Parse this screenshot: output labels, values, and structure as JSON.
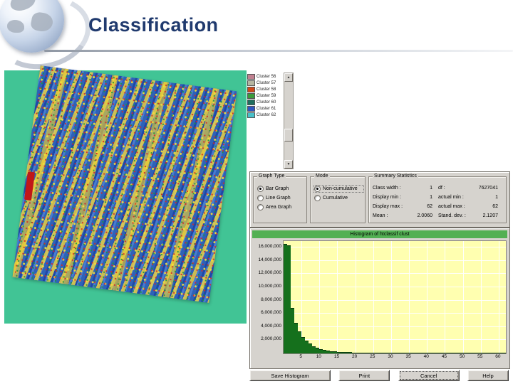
{
  "slide": {
    "title": "Classification"
  },
  "icons": {
    "scroll_up": "▲",
    "scroll_down": "▼"
  },
  "colors": {
    "panel_teal": "#41c495",
    "dialog_gray": "#d6d3ce",
    "bar_green": "#15701c",
    "plot_yellow": "#ffffb0",
    "hist_title_green": "#53b053",
    "title_navy": "#203a6e"
  },
  "legend": {
    "items": [
      {
        "label": "Cluster 56",
        "color": "#c08090"
      },
      {
        "label": "Cluster 57",
        "color": "#b5b5a0"
      },
      {
        "label": "Cluster 58",
        "color": "#d04818"
      },
      {
        "label": "Cluster 59",
        "color": "#3a9a3a"
      },
      {
        "label": "Cluster 60",
        "color": "#1f6e5e"
      },
      {
        "label": "Cluster 61",
        "color": "#2f55c0"
      },
      {
        "label": "Cluster 62",
        "color": "#49c0c9"
      }
    ]
  },
  "dialog": {
    "graph_type": {
      "label": "Graph Type",
      "options": [
        {
          "label": "Bar Graph",
          "selected": true
        },
        {
          "label": "Line Graph",
          "selected": false
        },
        {
          "label": "Area Graph",
          "selected": false
        }
      ]
    },
    "mode": {
      "label": "Mode",
      "options": [
        {
          "label": "Non-cumulative",
          "selected": true
        },
        {
          "label": "Cumulative",
          "selected": false
        }
      ]
    },
    "stats": {
      "label": "Summary Statistics",
      "left": [
        [
          "Class width :",
          "1"
        ],
        [
          "Display min :",
          "1"
        ],
        [
          "Display max :",
          "62"
        ],
        [
          "Mean :",
          "2.0060"
        ]
      ],
      "right": [
        [
          "df :",
          "7627041"
        ],
        [
          "actual min :",
          "1"
        ],
        [
          "actual max :",
          "62"
        ],
        [
          "Stand. dev. :",
          "2.1207"
        ]
      ]
    }
  },
  "histogram": {
    "title": "Histogram of htclassif clust"
  },
  "buttons": {
    "save": "Save Histogram",
    "print": "Print",
    "cancel": "Cancel",
    "help": "Help"
  },
  "chart_data": {
    "type": "bar",
    "title": "Histogram of htclassif clust",
    "xlabel": "",
    "ylabel": "",
    "xlim": [
      0,
      62
    ],
    "ylim": [
      0,
      17000000
    ],
    "grid": true,
    "legend_position": "none",
    "xticks": [
      5,
      10,
      15,
      20,
      25,
      30,
      35,
      40,
      45,
      50,
      55,
      60
    ],
    "yticks": [
      2000000,
      4000000,
      6000000,
      8000000,
      10000000,
      12000000,
      14000000,
      16000000
    ],
    "ytick_labels": [
      "2,000,000",
      "4,000,000",
      "6,000,000",
      "8,000,000",
      "10,000,000",
      "12,000,000",
      "14,000,000",
      "16,000,000"
    ],
    "bin_start": 1,
    "values": [
      16500000,
      16200000,
      6800000,
      4500000,
      3200000,
      2400000,
      1800000,
      1350000,
      1000000,
      760000,
      570000,
      430000,
      320000,
      240000,
      180000,
      135000,
      100000,
      76000,
      57000,
      43000,
      32000,
      24000,
      18000,
      14000,
      10000,
      8000,
      6000,
      4500,
      3400,
      2600,
      1900,
      1500,
      1100,
      850,
      640,
      480,
      360,
      270,
      200,
      150,
      115,
      86,
      65,
      49,
      37,
      28,
      21,
      16,
      12,
      9,
      7,
      5,
      4,
      3,
      2,
      2,
      1,
      1,
      1,
      1,
      1,
      1
    ]
  }
}
